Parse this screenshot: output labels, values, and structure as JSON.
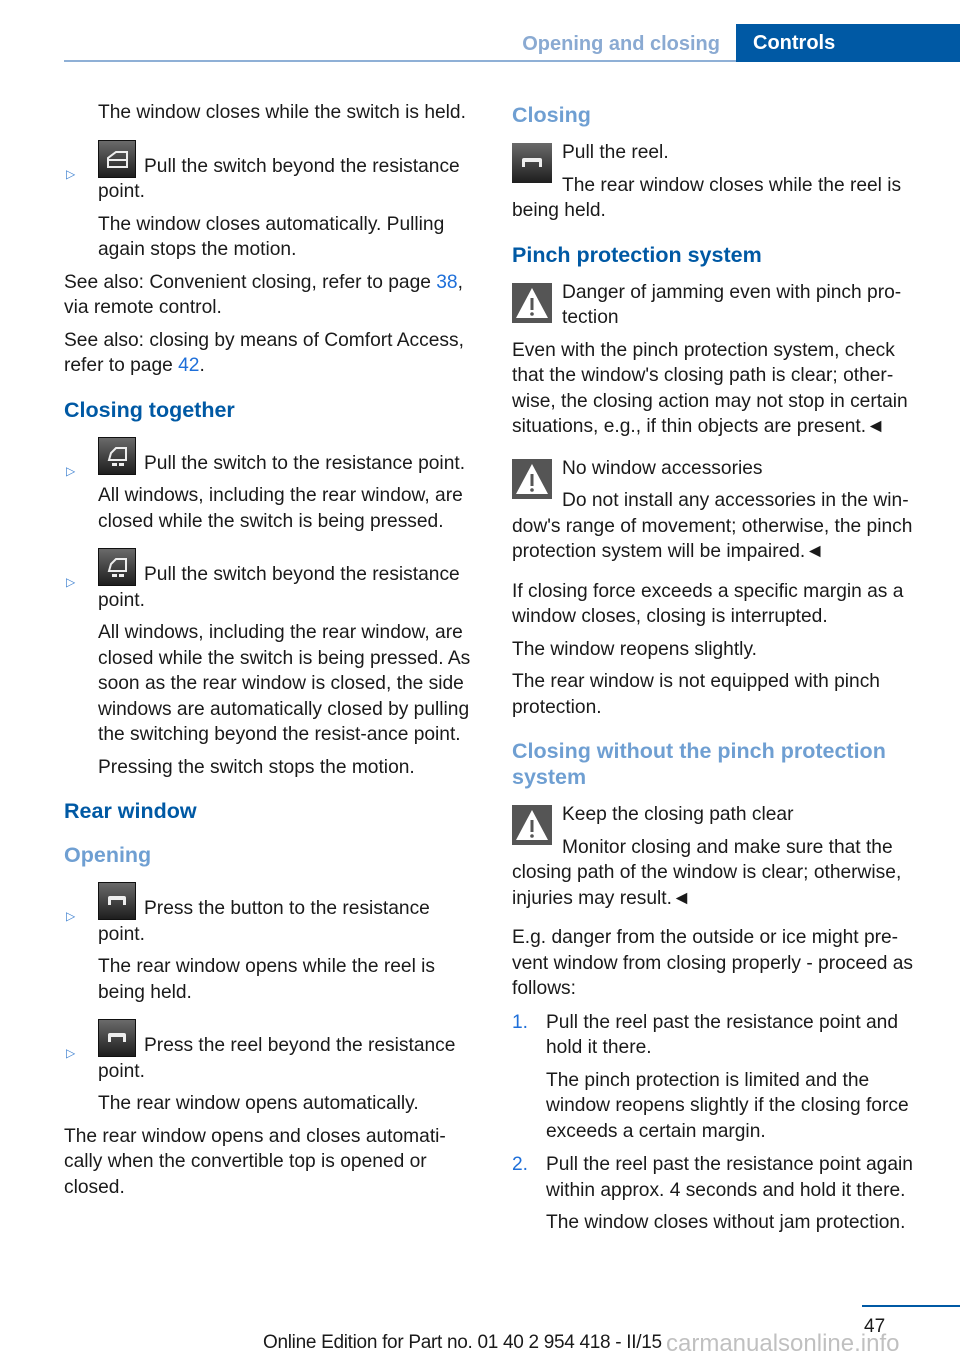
{
  "header": {
    "section": "Opening and closing",
    "chapter": "Controls"
  },
  "left": {
    "intro": "The window closes while the switch is held.",
    "bullet1": {
      "icon": "window-switch-single-icon",
      "line1": "Pull the switch beyond the resistance point.",
      "line2": "The window closes automatically. Pulling again stops the motion."
    },
    "seealso1": {
      "text": "See also: Convenient closing, refer to page ",
      "page": "38",
      "after": ", via remote control."
    },
    "seealso2": {
      "text": "See also: closing by means of Comfort Access, refer to page ",
      "page": "42",
      "after": "."
    },
    "closing_together": {
      "heading": "Closing together",
      "bullet1": {
        "icon": "window-switch-all-icon",
        "line1": "Pull the switch to the resistance point.",
        "line2": "All windows, including the rear window, are closed while the switch is being pressed."
      },
      "bullet2": {
        "icon": "window-switch-all-icon",
        "line1": "Pull the switch beyond the resistance point.",
        "line2": "All windows, including the rear window, are closed while the switch is being pressed. As soon as the rear window is closed, the side windows are automatically closed by pulling the switching beyond the resist-ance point.",
        "line3": "Pressing the switch stops the motion."
      }
    },
    "rear_window": {
      "heading": "Rear window",
      "opening_heading": "Opening",
      "bullet1": {
        "icon": "rear-window-button-icon",
        "line1": "Press the button to the resistance point.",
        "line2": "The rear window opens while the reel is being held."
      },
      "bullet2": {
        "icon": "rear-window-button-icon",
        "line1": "Press the reel beyond the resistance point.",
        "line2": "The rear window opens automatically."
      },
      "closing_note": "The rear window opens and closes automati-cally when the convertible top is opened or closed."
    }
  },
  "right": {
    "closing": {
      "heading": "Closing",
      "line1": "Pull the reel.",
      "line2": "The rear window closes while the reel is being held."
    },
    "pinch": {
      "heading": "Pinch protection system",
      "warn1_title": "Danger of jamming even with pinch pro-tection",
      "warn1_body": "Even with the pinch protection system, check that the window's closing path is clear; other-wise, the closing action may not stop in certain situations, e.g., if thin objects are present.◄",
      "warn2_title": "No window accessories",
      "warn2_body": "Do not install any accessories in the win-dow's range of movement; otherwise, the pinch protection system will be impaired.◄",
      "p1": "If closing force exceeds a specific margin as a window closes, closing is interrupted.",
      "p2": "The window reopens slightly.",
      "p3": "The rear window is not equipped with pinch protection."
    },
    "without": {
      "heading": "Closing without the pinch protection system",
      "warn_title": "Keep the closing path clear",
      "warn_body": "Monitor closing and make sure that the closing path of the window is clear; otherwise, injuries may result.◄",
      "intro": "E.g. danger from the outside or ice might pre-vent window from closing properly - proceed as follows:",
      "steps": [
        {
          "n": "1.",
          "text": "Pull the reel past the resistance point and hold it there.",
          "sub": "The pinch protection is limited and the window reopens slightly if the closing force exceeds a certain margin."
        },
        {
          "n": "2.",
          "text": "Pull the reel past the resistance point again within approx. 4 seconds and hold it there.",
          "sub": "The window closes without jam protection."
        }
      ]
    }
  },
  "footer": {
    "page_number": "47",
    "edition": "Online Edition for Part no. 01 40 2 954 418 - II/15",
    "watermark": "carmanualsonline.info"
  }
}
